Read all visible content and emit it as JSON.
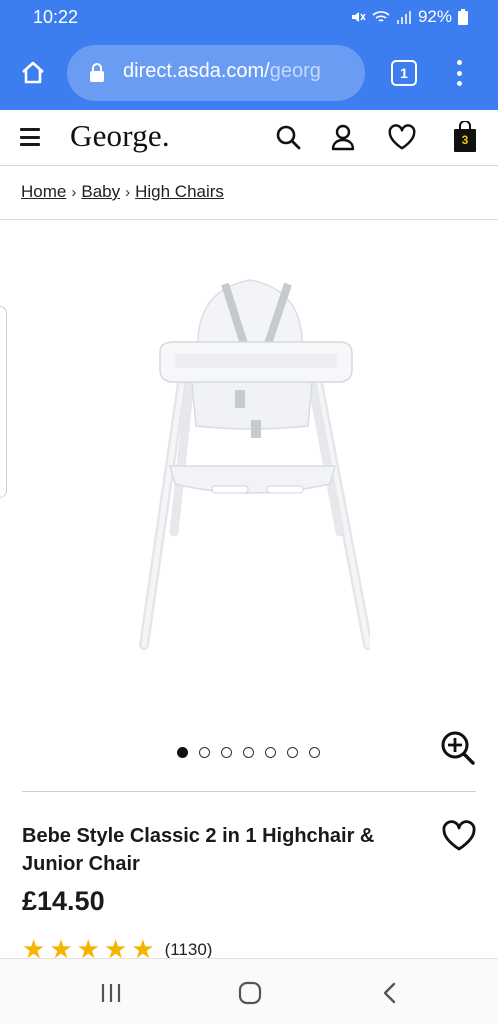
{
  "status_bar": {
    "time": "10:22",
    "battery": "92%",
    "icons": [
      "mute-icon",
      "wifi-icon",
      "signal-icon",
      "battery-icon"
    ]
  },
  "browser": {
    "url_main": "direct.asda.com/",
    "url_faded": "georg",
    "tab_count": "1",
    "icons": [
      "home-icon",
      "lock-icon",
      "tabs-icon",
      "overflow-menu-icon"
    ]
  },
  "header": {
    "logo": "George.",
    "bag_count": "3",
    "icons": [
      "hamburger-icon",
      "search-icon",
      "account-icon",
      "wishlist-icon",
      "bag-icon"
    ]
  },
  "breadcrumb": {
    "items": [
      "Home",
      "Baby",
      "High Chairs"
    ],
    "separator": "›"
  },
  "gallery": {
    "image_alt": "High chair product image",
    "slide_count": 7,
    "active_slide": 1,
    "zoom_icon": "zoom-in-icon"
  },
  "product": {
    "title": "Bebe Style Classic 2 in 1 Highchair & Junior Chair",
    "price": "£14.50",
    "rating_stars": 5,
    "review_count": "(1130)",
    "wishlist_icon": "heart-icon"
  },
  "colors": {
    "browser_blue": "#3c7df0",
    "url_box": "#6a9cf4",
    "star_gold": "#f5b400",
    "bag_badge": "#f5c400"
  },
  "android_nav": {
    "icons": [
      "recents-icon",
      "home-circle-icon",
      "back-icon"
    ]
  }
}
